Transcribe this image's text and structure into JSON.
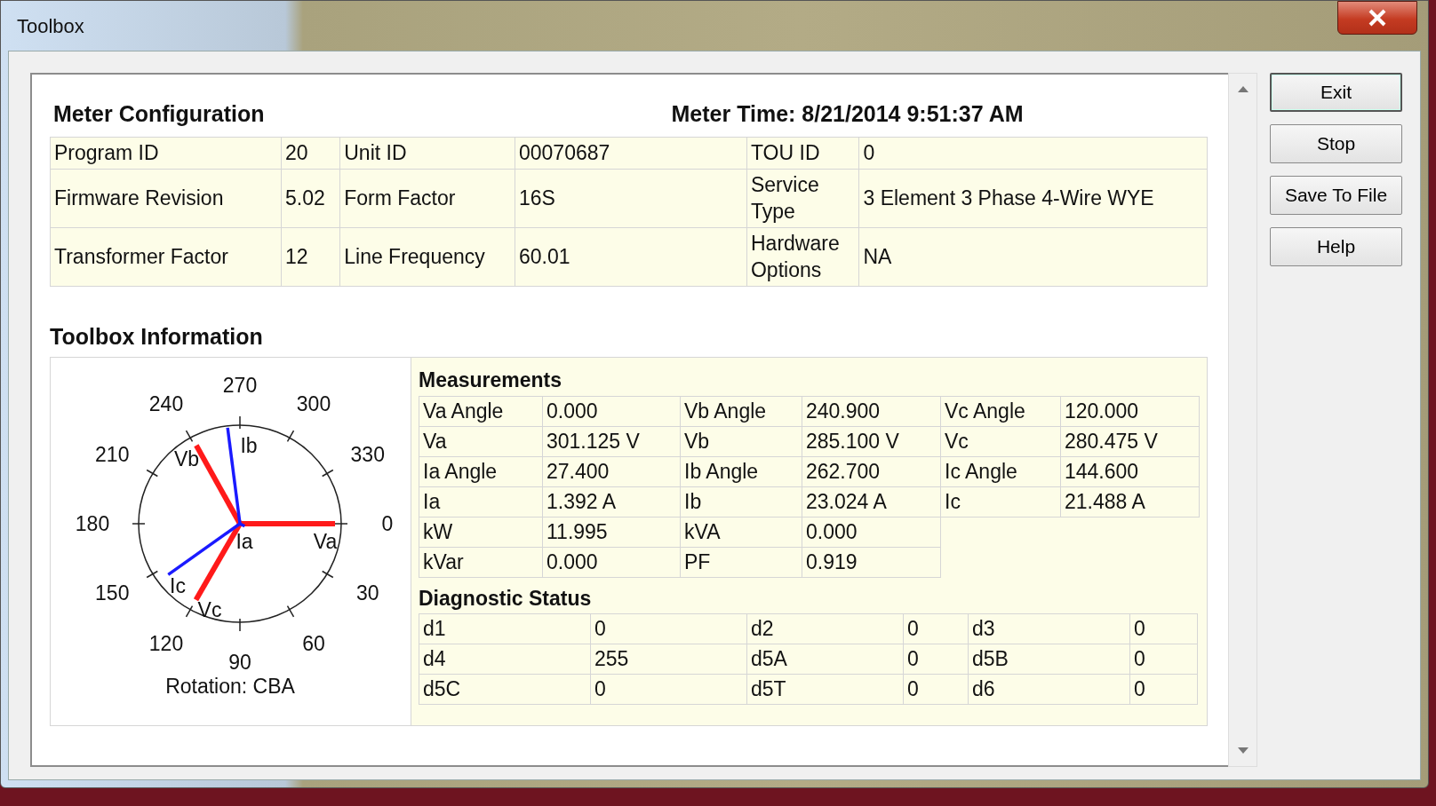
{
  "window": {
    "title": "Toolbox"
  },
  "meter_configuration": {
    "title": "Meter Configuration",
    "meter_time": "Meter Time: 8/21/2014 9:51:37 AM",
    "rows": [
      [
        "Program ID",
        "20",
        "Unit ID",
        "00070687",
        "TOU ID",
        "0"
      ],
      [
        "Firmware Revision",
        "5.02",
        "Form Factor",
        "16S",
        "Service Type",
        "3 Element 3 Phase 4-Wire WYE"
      ],
      [
        "Transformer Factor",
        "12",
        "Line Frequency",
        "60.01",
        "Hardware Options",
        "NA"
      ]
    ]
  },
  "toolbox_information": {
    "title": "Toolbox Information",
    "phasor": {
      "angle_labels": [
        "0",
        "30",
        "60",
        "90",
        "120",
        "150",
        "180",
        "210",
        "240",
        "270",
        "300",
        "330"
      ],
      "vectors": [
        {
          "label": "Va",
          "kind": "voltage"
        },
        {
          "label": "Vb",
          "kind": "voltage"
        },
        {
          "label": "Vc",
          "kind": "voltage"
        },
        {
          "label": "Ia",
          "kind": "current"
        },
        {
          "label": "Ib",
          "kind": "current"
        },
        {
          "label": "Ic",
          "kind": "current"
        }
      ],
      "rotation": "Rotation: CBA"
    },
    "measurements": {
      "title": "Measurements",
      "rows": [
        [
          "Va Angle",
          "0.000",
          "Vb Angle",
          "240.900",
          "Vc Angle",
          "120.000"
        ],
        [
          "Va",
          "301.125 V",
          "Vb",
          "285.100 V",
          "Vc",
          "280.475 V"
        ],
        [
          "Ia Angle",
          "27.400",
          "Ib Angle",
          "262.700",
          "Ic Angle",
          "144.600"
        ],
        [
          "Ia",
          "1.392 A",
          "Ib",
          "23.024 A",
          "Ic",
          "21.488 A"
        ],
        [
          "kW",
          "11.995",
          "kVA",
          "0.000"
        ],
        [
          "kVar",
          "0.000",
          "PF",
          "0.919"
        ]
      ]
    },
    "diagnostic_status": {
      "title": "Diagnostic Status",
      "rows": [
        [
          "d1",
          "0",
          "d2",
          "0",
          "d3",
          "0"
        ],
        [
          "d4",
          "255",
          "d5A",
          "0",
          "d5B",
          "0"
        ],
        [
          "d5C",
          "0",
          "d5T",
          "0",
          "d6",
          "0"
        ]
      ]
    }
  },
  "buttons": [
    {
      "label": "Exit",
      "default": true
    },
    {
      "label": "Stop",
      "default": false
    },
    {
      "label": "Save To File",
      "default": false
    },
    {
      "label": "Help",
      "default": false
    }
  ]
}
